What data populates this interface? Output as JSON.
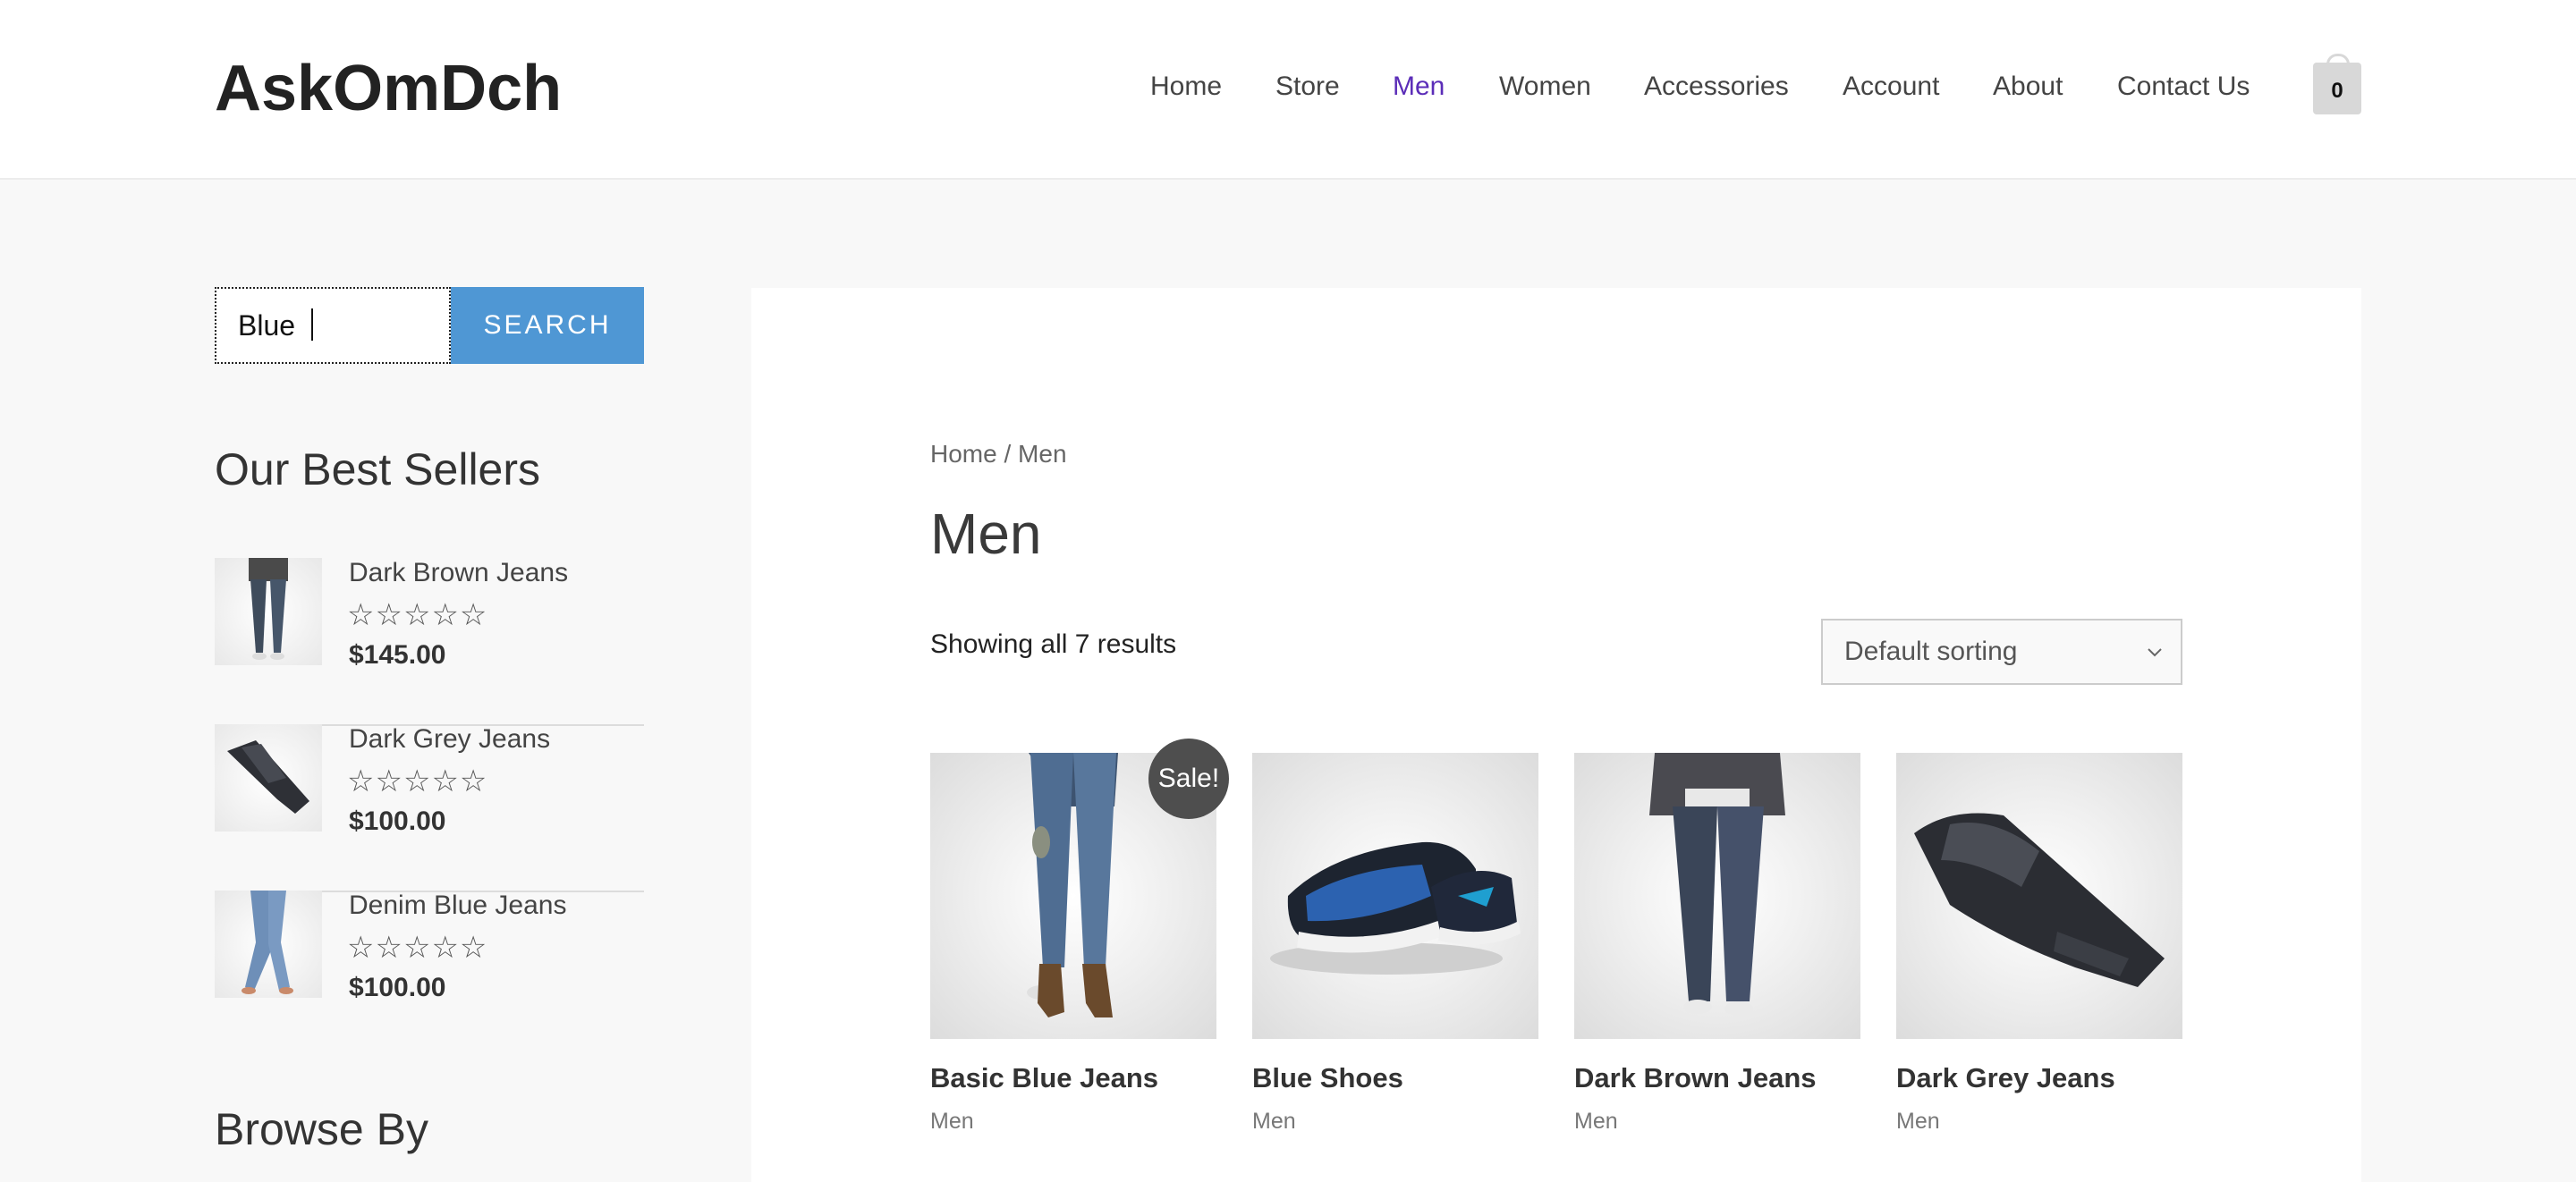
{
  "header": {
    "logo": "AskOmDch",
    "nav": [
      {
        "label": "Home",
        "active": false
      },
      {
        "label": "Store",
        "active": false
      },
      {
        "label": "Men",
        "active": true
      },
      {
        "label": "Women",
        "active": false
      },
      {
        "label": "Accessories",
        "active": false
      },
      {
        "label": "Account",
        "active": false
      },
      {
        "label": "About",
        "active": false
      },
      {
        "label": "Contact Us",
        "active": false
      }
    ],
    "cart_count": "0"
  },
  "sidebar": {
    "search": {
      "value": "Blue",
      "button_label": "SEARCH"
    },
    "best_sellers_title": "Our Best Sellers",
    "best_sellers": [
      {
        "name": "Dark Brown Jeans",
        "rating": "☆☆☆☆☆",
        "price": "$145.00",
        "image": "dark-brown-jeans-thumb"
      },
      {
        "name": "Dark Grey Jeans",
        "rating": "☆☆☆☆☆",
        "price": "$100.00",
        "image": "dark-grey-jeans-thumb"
      },
      {
        "name": "Denim Blue Jeans",
        "rating": "☆☆☆☆☆",
        "price": "$100.00",
        "image": "denim-blue-jeans-thumb"
      }
    ],
    "browse_title": "Browse By"
  },
  "main": {
    "breadcrumb": {
      "home": "Home",
      "separator": " / ",
      "current": "Men"
    },
    "title": "Men",
    "result_count": "Showing all 7 results",
    "sorting": {
      "selected": "Default sorting"
    },
    "sale_badge": "Sale!",
    "products": [
      {
        "name": "Basic Blue Jeans",
        "category": "Men",
        "image": "basic-blue-jeans-photo",
        "on_sale": true
      },
      {
        "name": "Blue Shoes",
        "category": "Men",
        "image": "blue-shoes-photo",
        "on_sale": false
      },
      {
        "name": "Dark Brown Jeans",
        "category": "Men",
        "image": "dark-brown-jeans-photo",
        "on_sale": false
      },
      {
        "name": "Dark Grey Jeans",
        "category": "Men",
        "image": "dark-grey-jeans-photo",
        "on_sale": false
      }
    ]
  },
  "colors": {
    "accent_nav_active": "#5b2db8",
    "search_button": "#4f97d4",
    "sale_badge": "#4e4e4e",
    "page_background": "#f8f8f8"
  }
}
